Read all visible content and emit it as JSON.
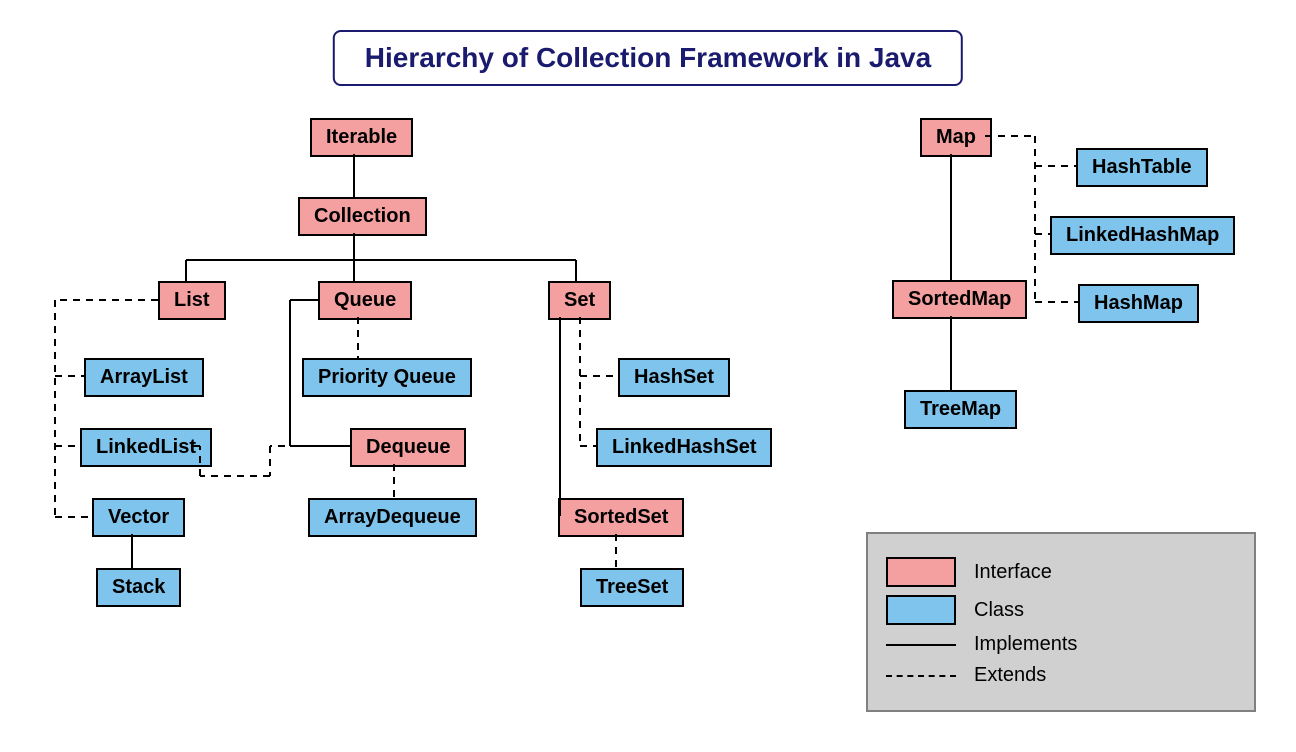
{
  "title": "Hierarchy of Collection Framework in Java",
  "nodes": {
    "iterable": "Iterable",
    "collection": "Collection",
    "list": "List",
    "queue": "Queue",
    "set": "Set",
    "arraylist": "ArrayList",
    "linkedlist": "LinkedList",
    "vector": "Vector",
    "stack": "Stack",
    "priorityqueue": "Priority Queue",
    "dequeue": "Dequeue",
    "arraydequeue": "ArrayDequeue",
    "hashset": "HashSet",
    "linkedhashset": "LinkedHashSet",
    "sortedset": "SortedSet",
    "treeset": "TreeSet",
    "map": "Map",
    "hashtable": "HashTable",
    "linkedhashmap": "LinkedHashMap",
    "hashmap": "HashMap",
    "sortedmap": "SortedMap",
    "treemap": "TreeMap"
  },
  "legend": {
    "interface": "Interface",
    "class": "Class",
    "implements": "Implements",
    "extends": "Extends"
  },
  "colors": {
    "interface": "#f5a0a0",
    "class": "#7fc4ec",
    "title_border": "#1a1a6e",
    "legend_bg": "#d0d0d0"
  },
  "chart_data": {
    "type": "diagram",
    "title": "Hierarchy of Collection Framework in Java",
    "interfaces": [
      "Iterable",
      "Collection",
      "List",
      "Queue",
      "Set",
      "Dequeue",
      "SortedSet",
      "Map",
      "SortedMap"
    ],
    "classes": [
      "ArrayList",
      "LinkedList",
      "Vector",
      "Stack",
      "Priority Queue",
      "ArrayDequeue",
      "HashSet",
      "LinkedHashSet",
      "TreeSet",
      "HashTable",
      "LinkedHashMap",
      "HashMap",
      "TreeMap"
    ],
    "edges": [
      {
        "from": "Iterable",
        "to": "Collection",
        "relation": "implements"
      },
      {
        "from": "Collection",
        "to": "List",
        "relation": "implements"
      },
      {
        "from": "Collection",
        "to": "Queue",
        "relation": "implements"
      },
      {
        "from": "Collection",
        "to": "Set",
        "relation": "implements"
      },
      {
        "from": "List",
        "to": "ArrayList",
        "relation": "extends"
      },
      {
        "from": "List",
        "to": "LinkedList",
        "relation": "extends"
      },
      {
        "from": "List",
        "to": "Vector",
        "relation": "extends"
      },
      {
        "from": "Vector",
        "to": "Stack",
        "relation": "implements"
      },
      {
        "from": "Queue",
        "to": "Priority Queue",
        "relation": "extends"
      },
      {
        "from": "Queue",
        "to": "Dequeue",
        "relation": "implements"
      },
      {
        "from": "Dequeue",
        "to": "LinkedList",
        "relation": "extends"
      },
      {
        "from": "Dequeue",
        "to": "ArrayDequeue",
        "relation": "extends"
      },
      {
        "from": "Set",
        "to": "HashSet",
        "relation": "extends"
      },
      {
        "from": "Set",
        "to": "LinkedHashSet",
        "relation": "extends"
      },
      {
        "from": "Set",
        "to": "SortedSet",
        "relation": "implements"
      },
      {
        "from": "SortedSet",
        "to": "TreeSet",
        "relation": "extends"
      },
      {
        "from": "Map",
        "to": "HashTable",
        "relation": "extends"
      },
      {
        "from": "Map",
        "to": "LinkedHashMap",
        "relation": "extends"
      },
      {
        "from": "Map",
        "to": "HashMap",
        "relation": "extends"
      },
      {
        "from": "Map",
        "to": "SortedMap",
        "relation": "implements"
      },
      {
        "from": "SortedMap",
        "to": "TreeMap",
        "relation": "implements"
      }
    ]
  }
}
